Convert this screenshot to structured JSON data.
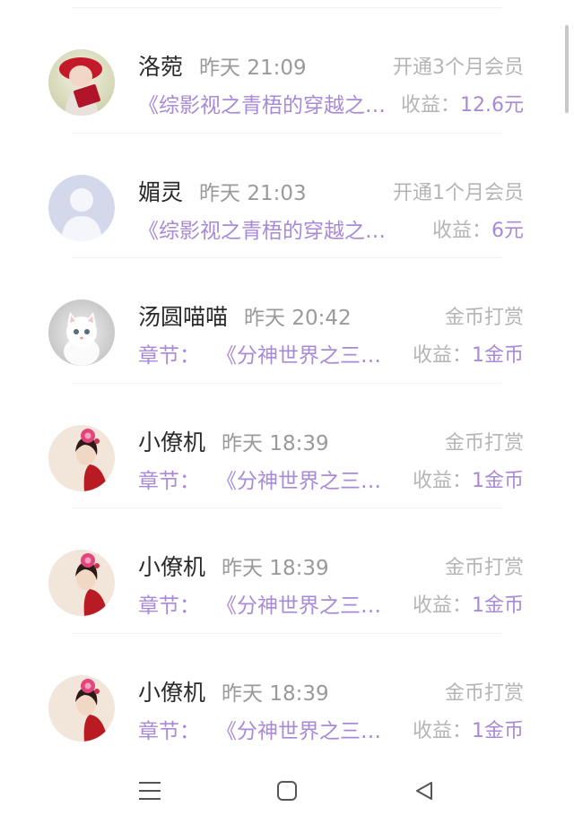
{
  "records": [
    {
      "name": "洛菀",
      "time": "昨天 21:09",
      "prefix": "",
      "book": "《综影视之青梧的穿越之旅》",
      "type": "开通3个月会员",
      "income_label": "收益：",
      "income_value": "12.6元",
      "avatar": "avatar-red-hat-girl"
    },
    {
      "name": "媚灵",
      "time": "昨天 21:03",
      "prefix": "",
      "book": "《综影视之青梧的穿越之旅》",
      "type": "开通1个月会员",
      "income_label": "收益：",
      "income_value": "6元",
      "avatar": "avatar-default-person"
    },
    {
      "name": "汤圆喵喵",
      "time": "昨天 20:42",
      "prefix": "章节：",
      "book": "《分神世界之三生三世》",
      "type": "金币打赏",
      "income_label": "收益：",
      "income_value": "1金币",
      "avatar": "avatar-white-kitten"
    },
    {
      "name": "小僚机",
      "time": "昨天 18:39",
      "prefix": "章节：",
      "book": "《分神世界之三生三世》",
      "type": "金币打赏",
      "income_label": "收益：",
      "income_value": "1金币",
      "avatar": "avatar-flower-lady"
    },
    {
      "name": "小僚机",
      "time": "昨天 18:39",
      "prefix": "章节：",
      "book": "《分神世界之三生三世》",
      "type": "金币打赏",
      "income_label": "收益：",
      "income_value": "1金币",
      "avatar": "avatar-flower-lady"
    },
    {
      "name": "小僚机",
      "time": "昨天 18:39",
      "prefix": "章节：",
      "book": "《分神世界之三生三世》",
      "type": "金币打赏",
      "income_label": "收益：",
      "income_value": "1金币",
      "avatar": "avatar-flower-lady"
    }
  ],
  "colors": {
    "accent_purple": "#a88ad8",
    "name_text": "#2a2a2a",
    "muted_text": "#9a9a9a",
    "light_text": "#b5b5b5"
  },
  "navbar": {
    "menu_icon": "menu-icon",
    "home_icon": "home-square-icon",
    "back_icon": "back-triangle-icon"
  }
}
